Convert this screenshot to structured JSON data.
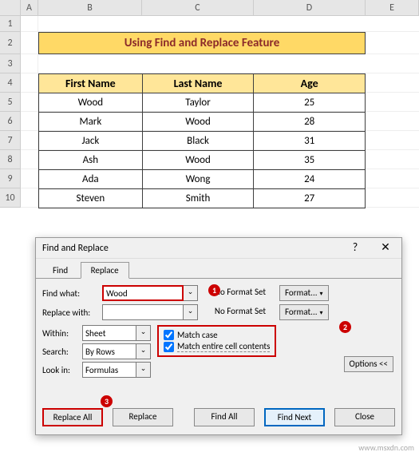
{
  "columns": [
    "A",
    "B",
    "C",
    "D",
    "E"
  ],
  "rownums": [
    "1",
    "2",
    "3",
    "4",
    "5",
    "6",
    "7",
    "8",
    "9",
    "10"
  ],
  "title": "Using Find and Replace Feature",
  "headers": {
    "first": "First Name",
    "last": "Last Name",
    "age": "Age"
  },
  "chart_data": {
    "type": "table",
    "columns": [
      "First Name",
      "Last Name",
      "Age"
    ],
    "rows": [
      [
        "Wood",
        "Taylor",
        "25"
      ],
      [
        "Mark",
        "Wood",
        "28"
      ],
      [
        "Jack",
        "Black",
        "31"
      ],
      [
        "Ash",
        "Wood",
        "35"
      ],
      [
        "Ada",
        "Wong",
        "24"
      ],
      [
        "Steven",
        "Smith",
        "27"
      ]
    ]
  },
  "dialog": {
    "title": "Find and Replace",
    "help": "?",
    "close": "✕",
    "tabs": {
      "find": "Find",
      "replace": "Replace"
    },
    "findwhat_lbl": "Find what:",
    "findwhat_val": "Wood",
    "repwith_lbl": "Replace with:",
    "repwith_val": "",
    "noformat": "No Format Set",
    "format": "Format...",
    "chev": "▾",
    "within_lbl": "Within:",
    "within_val": "Sheet",
    "search_lbl": "Search:",
    "search_val": "By Rows",
    "lookin_lbl": "Look in:",
    "lookin_val": "Formulas",
    "matchcase": "Match case",
    "matchentire": "Match entire cell contents",
    "options": "Options <<",
    "replaceall": "Replace All",
    "replace": "Replace",
    "findall": "Find All",
    "findnext": "Find Next",
    "close_btn": "Close"
  },
  "callouts": {
    "c1": "1",
    "c2": "2",
    "c3": "3"
  },
  "watermark": "www.msxdn.com"
}
